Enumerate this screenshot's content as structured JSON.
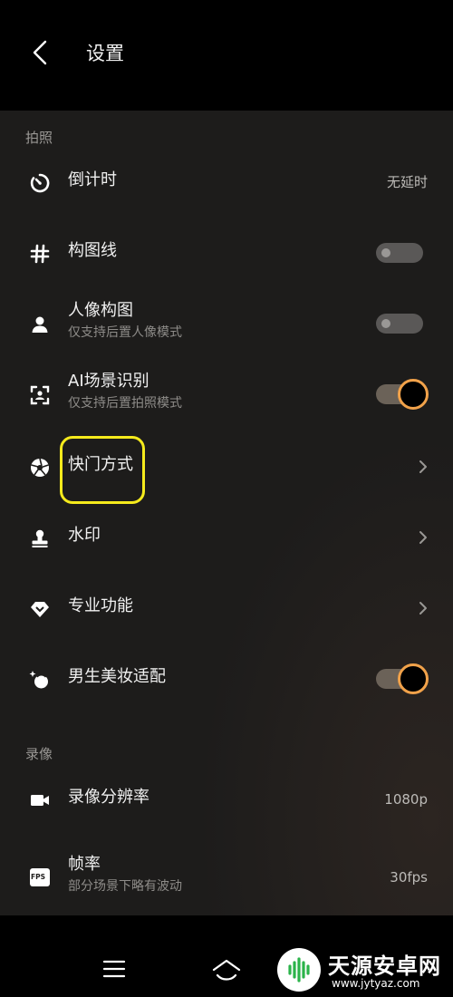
{
  "header": {
    "title": "设置"
  },
  "sections": {
    "photo": "拍照",
    "video": "录像"
  },
  "rows": {
    "countdown": {
      "label": "倒计时",
      "value": "无延时"
    },
    "grid": {
      "label": "构图线",
      "on": false
    },
    "portrait": {
      "label": "人像构图",
      "sub": "仅支持后置人像模式",
      "on": false
    },
    "ai_scene": {
      "label": "AI场景识别",
      "sub": "仅支持后置拍照模式",
      "on": true
    },
    "shutter": {
      "label": "快门方式"
    },
    "watermark": {
      "label": "水印"
    },
    "pro": {
      "label": "专业功能"
    },
    "male_beauty": {
      "label": "男生美妆适配",
      "on": true
    },
    "resolution": {
      "label": "录像分辨率",
      "value": "1080p"
    },
    "fps": {
      "label": "帧率",
      "sub": "部分场景下略有波动",
      "value": "30fps",
      "icon_text": "FPS"
    }
  },
  "watermark_overlay": {
    "title": "天源安卓网",
    "url": "www.jytyaz.com"
  },
  "colors": {
    "accent": "#f1a24a",
    "highlight": "#f5ea1c",
    "background": "#1d1c1b"
  }
}
